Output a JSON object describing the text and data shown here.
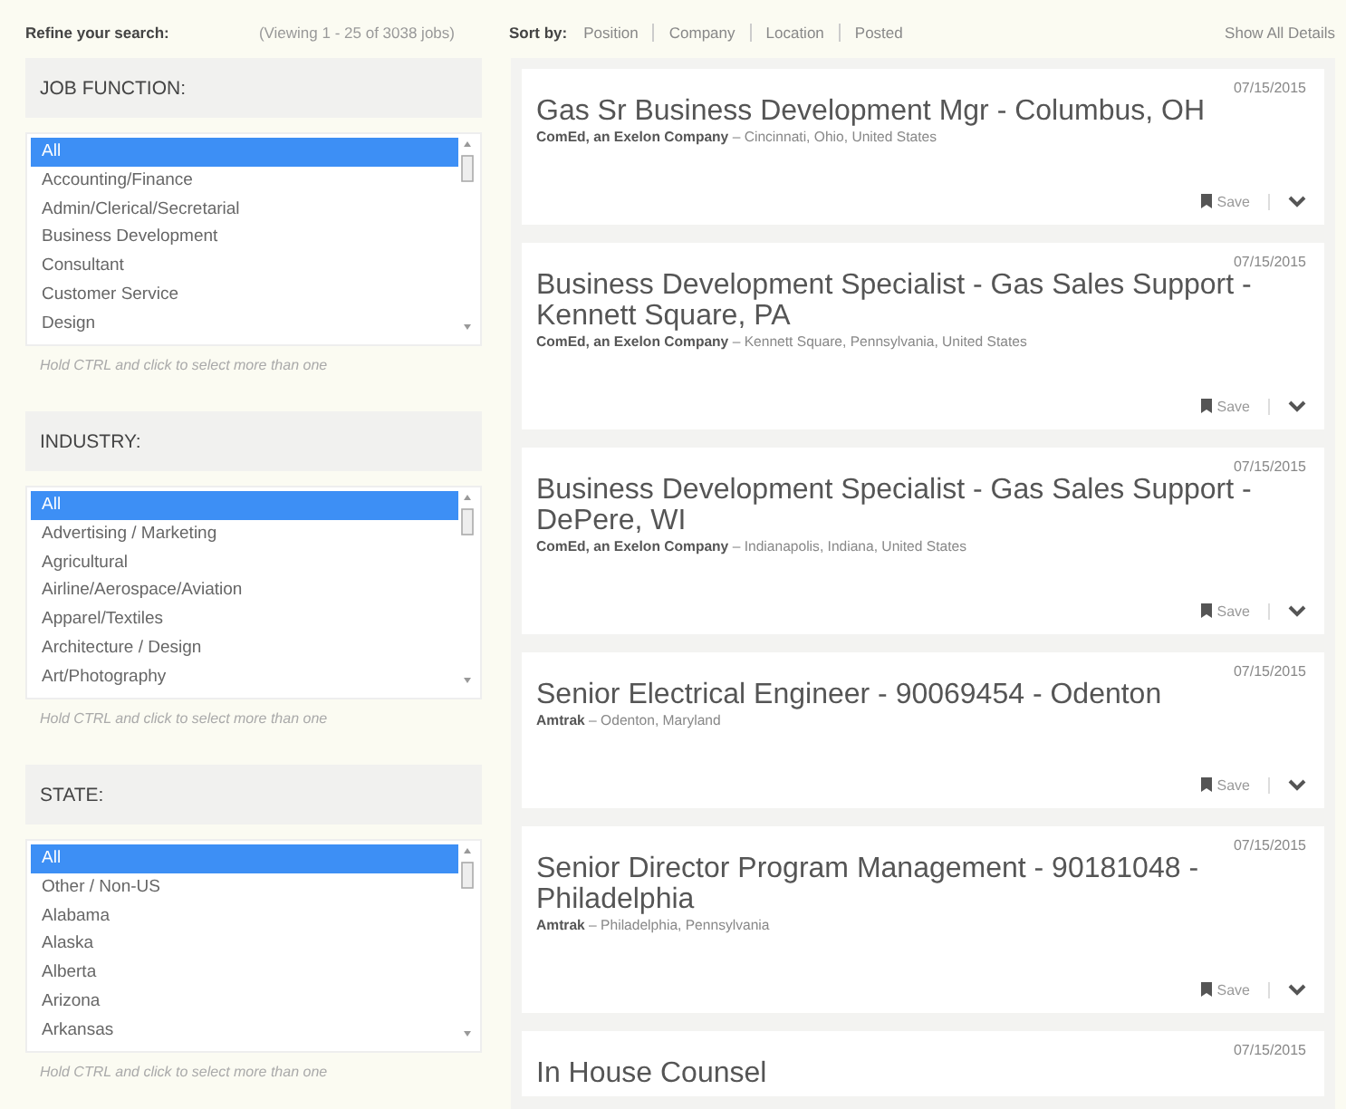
{
  "header": {
    "refine_label": "Refine your search:",
    "viewing": "(Viewing 1 - 25 of 3038 jobs)",
    "sort_label": "Sort by:",
    "sort_options": [
      {
        "label": "Position"
      },
      {
        "label": "Company"
      },
      {
        "label": "Location"
      },
      {
        "label": "Posted"
      }
    ],
    "show_all": "Show All Details"
  },
  "filters": [
    {
      "title": "JOB FUNCTION:",
      "hint": "Hold CTRL and click to select more than one",
      "options": [
        {
          "label": "All",
          "selected": true
        },
        {
          "label": "Accounting/Finance",
          "selected": false
        },
        {
          "label": "Admin/Clerical/Secretarial",
          "selected": false
        },
        {
          "label": "Business Development",
          "selected": false
        },
        {
          "label": "Consultant",
          "selected": false
        },
        {
          "label": "Customer Service",
          "selected": false
        },
        {
          "label": "Design",
          "selected": false
        }
      ]
    },
    {
      "title": "INDUSTRY:",
      "hint": "Hold CTRL and click to select more than one",
      "options": [
        {
          "label": "All",
          "selected": true
        },
        {
          "label": "Advertising / Marketing",
          "selected": false
        },
        {
          "label": "Agricultural",
          "selected": false
        },
        {
          "label": "Airline/Aerospace/Aviation",
          "selected": false
        },
        {
          "label": "Apparel/Textiles",
          "selected": false
        },
        {
          "label": "Architecture / Design",
          "selected": false
        },
        {
          "label": "Art/Photography",
          "selected": false
        }
      ]
    },
    {
      "title": "STATE:",
      "hint": "Hold CTRL and click to select more than one",
      "options": [
        {
          "label": "All",
          "selected": true
        },
        {
          "label": "Other / Non-US",
          "selected": false
        },
        {
          "label": "Alabama",
          "selected": false
        },
        {
          "label": "Alaska",
          "selected": false
        },
        {
          "label": "Alberta",
          "selected": false
        },
        {
          "label": "Arizona",
          "selected": false
        },
        {
          "label": "Arkansas",
          "selected": false
        }
      ]
    }
  ],
  "jobs": [
    {
      "date": "07/15/2015",
      "title": "Gas Sr Business Development Mgr - Columbus, OH",
      "company": "ComEd, an Exelon Company",
      "location": "– Cincinnati, Ohio, United States",
      "save_label": "Save"
    },
    {
      "date": "07/15/2015",
      "title": "Business Development Specialist - Gas Sales Support - Kennett Square, PA",
      "company": "ComEd, an Exelon Company",
      "location": "– Kennett Square, Pennsylvania, United States",
      "save_label": "Save"
    },
    {
      "date": "07/15/2015",
      "title": "Business Development Specialist - Gas Sales Support - DePere, WI",
      "company": "ComEd, an Exelon Company",
      "location": "– Indianapolis, Indiana, United States",
      "save_label": "Save"
    },
    {
      "date": "07/15/2015",
      "title": "Senior Electrical Engineer - 90069454 - Odenton",
      "company": "Amtrak",
      "location": "– Odenton, Maryland",
      "save_label": "Save"
    },
    {
      "date": "07/15/2015",
      "title": "Senior Director Program Management - 90181048 - Philadelphia",
      "company": "Amtrak",
      "location": "– Philadelphia, Pennsylvania",
      "save_label": "Save"
    },
    {
      "date": "07/15/2015",
      "title": "In House Counsel"
    }
  ]
}
